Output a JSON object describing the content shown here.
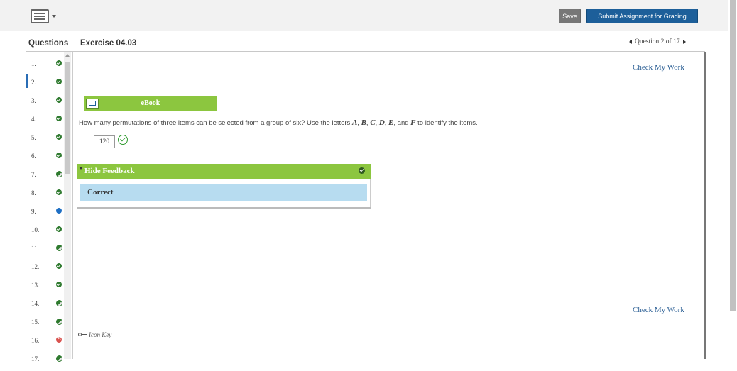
{
  "toolbar": {
    "keyboard_icon": "keyboard-icon",
    "save_label": "Save",
    "submit_label": "Submit Assignment for Grading"
  },
  "header": {
    "questions_label": "Questions",
    "exercise_title": "Exercise 04.03",
    "question_nav": "Question 2 of 17"
  },
  "sidebar": {
    "items": [
      {
        "num": "1.",
        "status": "done"
      },
      {
        "num": "2.",
        "status": "done"
      },
      {
        "num": "3.",
        "status": "done"
      },
      {
        "num": "4.",
        "status": "done"
      },
      {
        "num": "5.",
        "status": "done"
      },
      {
        "num": "6.",
        "status": "done"
      },
      {
        "num": "7.",
        "status": "partial"
      },
      {
        "num": "8.",
        "status": "done"
      },
      {
        "num": "9.",
        "status": "dot"
      },
      {
        "num": "10.",
        "status": "done"
      },
      {
        "num": "11.",
        "status": "partial"
      },
      {
        "num": "12.",
        "status": "done"
      },
      {
        "num": "13.",
        "status": "done"
      },
      {
        "num": "14.",
        "status": "partial"
      },
      {
        "num": "15.",
        "status": "partial"
      },
      {
        "num": "16.",
        "status": "wrong"
      },
      {
        "num": "17.",
        "status": "partial"
      }
    ]
  },
  "main": {
    "check_my_work": "Check My Work",
    "ebook_label": "eBook",
    "question_parts": [
      "How many permutations of three items can be selected from a group of six? Use the letters ",
      "A",
      ", ",
      "B",
      ", ",
      "C",
      ", ",
      "D",
      ", ",
      "E",
      ", and ",
      "F",
      " to identify the items."
    ],
    "answer_value": "120",
    "feedback_header": "Hide Feedback",
    "feedback_result": "Correct",
    "icon_key": "Icon Key"
  },
  "colors": {
    "accent_green": "#8cc63f",
    "submit_blue": "#1d5f9a",
    "correct_bg": "#b7dcf0",
    "link_blue": "#2a5e94"
  }
}
